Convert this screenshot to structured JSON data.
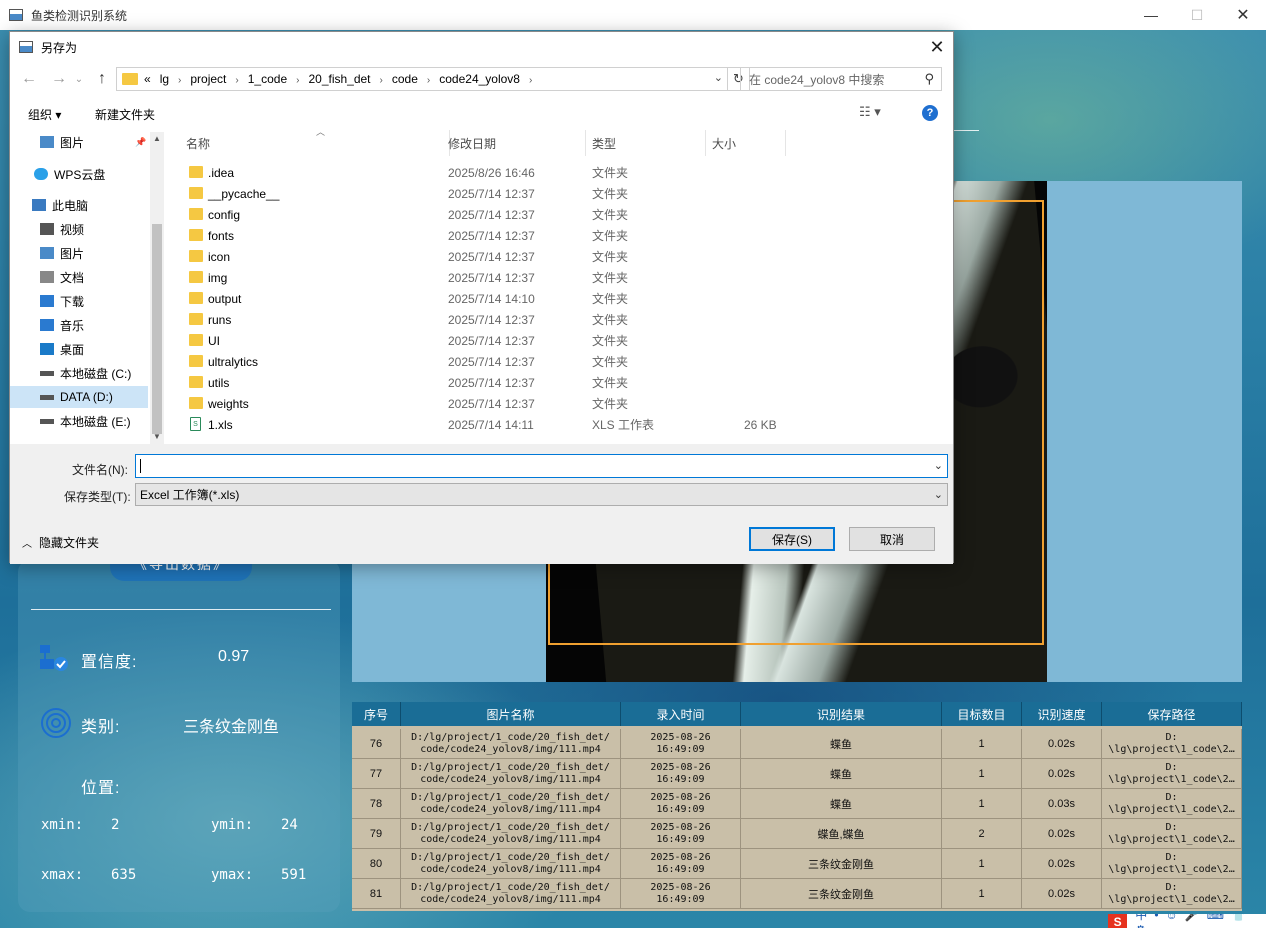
{
  "app": {
    "title": "鱼类检测识别系统",
    "export_label": "《导出数据》",
    "confidence": {
      "label": "置信度:",
      "value": "0.97"
    },
    "category": {
      "label": "类别:",
      "value": "三条纹金刚鱼"
    },
    "position_label": "位置:",
    "coords": {
      "xmin_label": "xmin:",
      "xmin": "2",
      "ymin_label": "ymin:",
      "ymin": "24",
      "xmax_label": "xmax:",
      "xmax": "635",
      "ymax_label": "ymax:",
      "ymax": "591"
    },
    "table": {
      "headers": [
        "序号",
        "图片名称",
        "录入时间",
        "识别结果",
        "目标数目",
        "识别速度",
        "保存路径"
      ],
      "rows": [
        [
          "76",
          "D:/lg/project/1_code/20_fish_det/\ncode/code24_yolov8/img/111.mp4",
          "2025-08-26\n16:49:09",
          "蝶鱼",
          "1",
          "0.02s",
          "D:\n\\lg\\project\\1_code\\2…"
        ],
        [
          "77",
          "D:/lg/project/1_code/20_fish_det/\ncode/code24_yolov8/img/111.mp4",
          "2025-08-26\n16:49:09",
          "蝶鱼",
          "1",
          "0.02s",
          "D:\n\\lg\\project\\1_code\\2…"
        ],
        [
          "78",
          "D:/lg/project/1_code/20_fish_det/\ncode/code24_yolov8/img/111.mp4",
          "2025-08-26\n16:49:09",
          "蝶鱼",
          "1",
          "0.03s",
          "D:\n\\lg\\project\\1_code\\2…"
        ],
        [
          "79",
          "D:/lg/project/1_code/20_fish_det/\ncode/code24_yolov8/img/111.mp4",
          "2025-08-26\n16:49:09",
          "蝶鱼,蝶鱼",
          "2",
          "0.02s",
          "D:\n\\lg\\project\\1_code\\2…"
        ],
        [
          "80",
          "D:/lg/project/1_code/20_fish_det/\ncode/code24_yolov8/img/111.mp4",
          "2025-08-26\n16:49:09",
          "三条纹金刚鱼",
          "1",
          "0.02s",
          "D:\n\\lg\\project\\1_code\\2…"
        ],
        [
          "81",
          "D:/lg/project/1_code/20_fish_det/\ncode/code24_yolov8/img/111.mp4",
          "2025-08-26\n16:49:09",
          "三条纹金刚鱼",
          "1",
          "0.02s",
          "D:\n\\lg\\project\\1_code\\2…"
        ]
      ]
    },
    "colors": {
      "accent": "#1f73b8",
      "table_header": "#1a6d96",
      "bbox": "#f0a030"
    }
  },
  "dialog": {
    "title": "另存为",
    "breadcrumbs": [
      "«",
      "lg",
      "project",
      "1_code",
      "20_fish_det",
      "code",
      "code24_yolov8"
    ],
    "search_placeholder": "在 code24_yolov8 中搜索",
    "organize_label": "组织 ▾",
    "new_folder_label": "新建文件夹",
    "nav_items": [
      {
        "label": "图片",
        "icon": "pictures-icon"
      },
      {
        "label": "WPS云盘",
        "icon": "cloud-icon"
      },
      {
        "label": "此电脑",
        "icon": "computer-icon"
      },
      {
        "label": "视频",
        "icon": "video-icon"
      },
      {
        "label": "图片",
        "icon": "pictures-icon"
      },
      {
        "label": "文档",
        "icon": "documents-icon"
      },
      {
        "label": "下载",
        "icon": "download-icon"
      },
      {
        "label": "音乐",
        "icon": "music-icon"
      },
      {
        "label": "桌面",
        "icon": "desktop-icon"
      },
      {
        "label": "本地磁盘 (C:)",
        "icon": "drive-icon"
      },
      {
        "label": "DATA (D:)",
        "icon": "drive-icon"
      },
      {
        "label": "本地磁盘 (E:)",
        "icon": "drive-icon"
      }
    ],
    "columns": {
      "name": "名称",
      "date": "修改日期",
      "type": "类型",
      "size": "大小"
    },
    "files": [
      {
        "name": ".idea",
        "date": "2025/8/26 16:46",
        "type": "文件夹",
        "size": ""
      },
      {
        "name": "__pycache__",
        "date": "2025/7/14 12:37",
        "type": "文件夹",
        "size": ""
      },
      {
        "name": "config",
        "date": "2025/7/14 12:37",
        "type": "文件夹",
        "size": ""
      },
      {
        "name": "fonts",
        "date": "2025/7/14 12:37",
        "type": "文件夹",
        "size": ""
      },
      {
        "name": "icon",
        "date": "2025/7/14 12:37",
        "type": "文件夹",
        "size": ""
      },
      {
        "name": "img",
        "date": "2025/7/14 12:37",
        "type": "文件夹",
        "size": ""
      },
      {
        "name": "output",
        "date": "2025/7/14 14:10",
        "type": "文件夹",
        "size": ""
      },
      {
        "name": "runs",
        "date": "2025/7/14 12:37",
        "type": "文件夹",
        "size": ""
      },
      {
        "name": "UI",
        "date": "2025/7/14 12:37",
        "type": "文件夹",
        "size": ""
      },
      {
        "name": "ultralytics",
        "date": "2025/7/14 12:37",
        "type": "文件夹",
        "size": ""
      },
      {
        "name": "utils",
        "date": "2025/7/14 12:37",
        "type": "文件夹",
        "size": ""
      },
      {
        "name": "weights",
        "date": "2025/7/14 12:37",
        "type": "文件夹",
        "size": ""
      },
      {
        "name": "1.xls",
        "date": "2025/7/14 14:11",
        "type": "XLS 工作表",
        "size": "26 KB"
      }
    ],
    "filename_label": "文件名(N):",
    "filename_value": "",
    "filetype_label": "保存类型(T):",
    "filetype_value": "Excel 工作簿(*.xls)",
    "hide_folders_label": "隐藏文件夹",
    "save_label": "保存(S)",
    "cancel_label": "取消"
  },
  "tray": {
    "items": [
      "中",
      "•",
      "☺",
      "🎤",
      "⌨",
      "👕",
      "⚙"
    ]
  }
}
